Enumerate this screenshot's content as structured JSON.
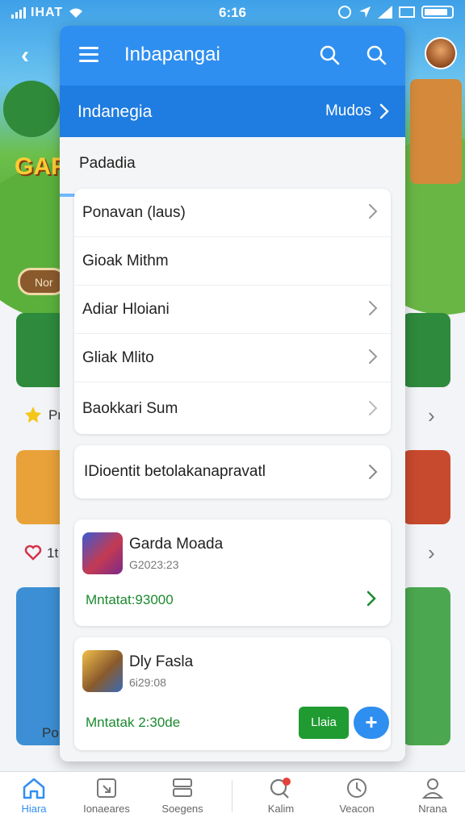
{
  "status_bar": {
    "carrier": "IHAT",
    "time": "6:16"
  },
  "overlay": {
    "title": "Inbapangai",
    "sub_header": {
      "title": "Indanegia",
      "link": "Mudos"
    },
    "section_label": "Padadia",
    "menu_items": [
      {
        "label": "Ponavan (laus)",
        "chevron": true
      },
      {
        "label": "Gioak Mithm",
        "chevron": false
      },
      {
        "label": "Adiar Hloiani",
        "chevron": true
      },
      {
        "label": "Gliak Mlito",
        "chevron": true
      },
      {
        "label": "Baokkari Sum",
        "chevron": true
      }
    ],
    "single_item": {
      "label": "IDioentit betolakanapravatl"
    },
    "games": [
      {
        "name": "Garda Moada",
        "sub": "G2023:23",
        "price": "Mntatat:93000"
      },
      {
        "name": "Dly Fasla",
        "sub": "6i29:08",
        "price": "Mntatak 2:30de",
        "button": "Llaia",
        "plus": "+"
      }
    ]
  },
  "background": {
    "logo": "GAR",
    "pill": "Nor",
    "row_texts": [
      "Pr",
      "1t",
      "Po"
    ]
  },
  "bottom_nav": [
    {
      "label": "Hiara",
      "icon": "home-icon",
      "active": true
    },
    {
      "label": "Ionaeares",
      "icon": "download-box-icon",
      "active": false
    },
    {
      "label": "Soegens",
      "icon": "stack-icon",
      "active": false
    },
    {
      "label": "Kalim",
      "icon": "search-notification-icon",
      "active": false
    },
    {
      "label": "Veacon",
      "icon": "clock-icon",
      "active": false
    },
    {
      "label": "Nrana",
      "icon": "profile-icon",
      "active": false
    }
  ],
  "colors": {
    "primary": "#2f8ff0",
    "primary_dark": "#1f7ce0",
    "green": "#1f9b32",
    "price_green": "#1b8a2f"
  }
}
